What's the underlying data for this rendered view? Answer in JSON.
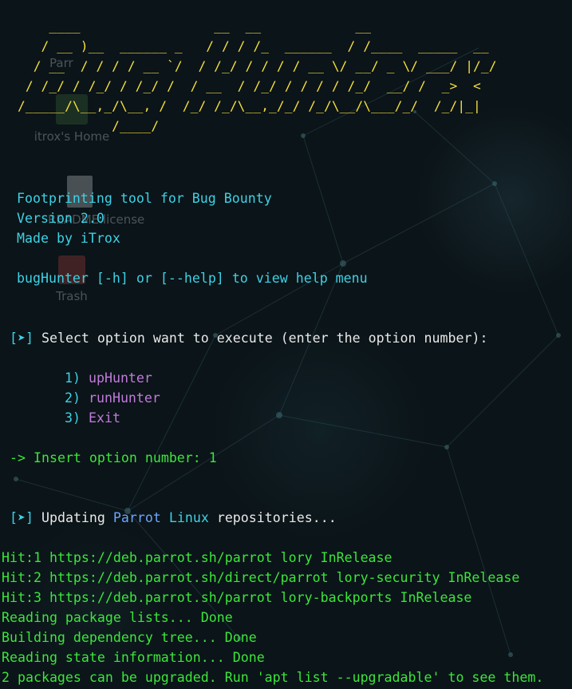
{
  "desktop": {
    "icons": [
      {
        "name": "home",
        "label": "itrox's Home",
        "icon": "home-folder-icon"
      },
      {
        "name": "file",
        "label": "README.license",
        "icon": "text-file-icon"
      },
      {
        "name": "trash",
        "label": "Trash",
        "icon": "trash-icon"
      }
    ],
    "partial_label": "Parr"
  },
  "banner": [
    "    ____                 __  __            __",
    "   / __ )__  ______ _   / / / /_  ______  / /____  _____  __",
    "  / __  / / / / __ `/  / /_/ / / / / __ \\/ __/ _ \\/ ___/ |/_/",
    " / /_/ / /_/ / /_/ /  / __  / /_/ / / / / /_/  __/ /  _>  <",
    "/_____/\\__,_/\\__, /  /_/ /_/\\__,_/_/ /_/\\__/\\___/_/  /_/|_|",
    "            /____/"
  ],
  "info": {
    "line1": "Footprinting tool for Bug Bounty",
    "line2": "Version 2.0",
    "line3": "Made by iTrox",
    "help_cmd": "bugHunter",
    "help_short": "[-h]",
    "help_or": "or",
    "help_long": "[--help]",
    "help_rest": "to view help menu"
  },
  "menu": {
    "prompt_icon": "[➤]",
    "prompt": "Select option want to execute (enter the option number):",
    "options": [
      {
        "num": "1)",
        "label": "upHunter"
      },
      {
        "num": "2)",
        "label": "runHunter"
      },
      {
        "num": "3)",
        "label": "Exit"
      }
    ]
  },
  "input": {
    "arrow": "->",
    "label": "Insert option number:",
    "value": "1"
  },
  "status": {
    "icon": "[➤]",
    "pre": "Updating",
    "distro1": "Parrot",
    "distro2": "Linux",
    "post": "repositories..."
  },
  "apt_output": [
    "Hit:1 https://deb.parrot.sh/parrot lory InRelease",
    "Hit:2 https://deb.parrot.sh/direct/parrot lory-security InRelease",
    "Hit:3 https://deb.parrot.sh/parrot lory-backports InRelease",
    "Reading package lists... Done",
    "Building dependency tree... Done",
    "Reading state information... Done",
    "2 packages can be upgraded. Run 'apt list --upgradable' to see them."
  ],
  "colors": {
    "banner": "#f5df3c",
    "info": "#3cd2e6",
    "text": "#e8e8e8",
    "output": "#3be63b",
    "option": "#c07adb"
  }
}
